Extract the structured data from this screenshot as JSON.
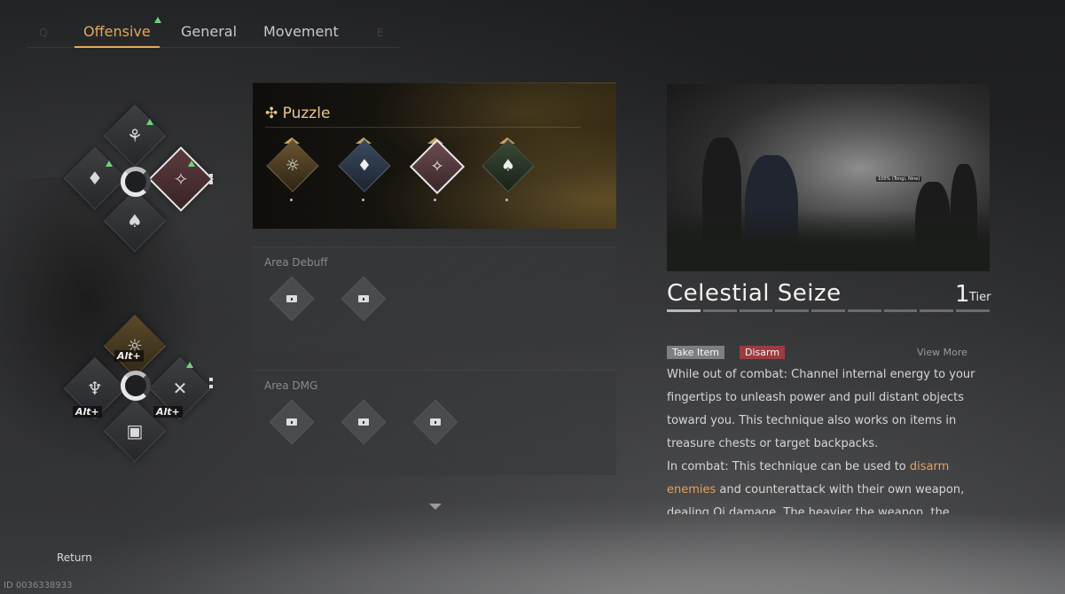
{
  "tabs": {
    "left_key": "Q",
    "right_key": "E",
    "items": [
      {
        "label": "Offensive",
        "active": true
      },
      {
        "label": "General",
        "active": false
      },
      {
        "label": "Movement",
        "active": false
      }
    ]
  },
  "wheel": {
    "alt_label": "Alt"
  },
  "sections": {
    "puzzle": {
      "title": "Puzzle",
      "icon": "puzzle-icon"
    },
    "area_debuff": {
      "title": "Area Debuff"
    },
    "area_dmg": {
      "title": "Area DMG"
    }
  },
  "details": {
    "preview_tag": "100% (Tongi, Nine)",
    "skill_name": "Celestial Seize",
    "tier_number": "1",
    "tier_label": "Tier",
    "tags": [
      "Take Item",
      "Disarm"
    ],
    "view_more": "View More",
    "desc1": "While out of combat: Channel internal energy to your fingertips to unleash power and pull distant objects toward you. This technique also works on items in treasure chests or target backpacks.",
    "desc2_a": "In combat: This technique can be used to ",
    "desc2_hl": "disarm enemies",
    "desc2_b": " and counterattack with their own weapon, dealing Qi damage. The heavier the weapon, the"
  },
  "footer": {
    "return_label": "Return",
    "uid": "ID 0036338933"
  },
  "colors": {
    "accent_gold": "#e2a75a",
    "highlight_orange": "#e3a25c",
    "upgrade_green": "#6fd27a",
    "disarm_red": "#9c3c42"
  }
}
